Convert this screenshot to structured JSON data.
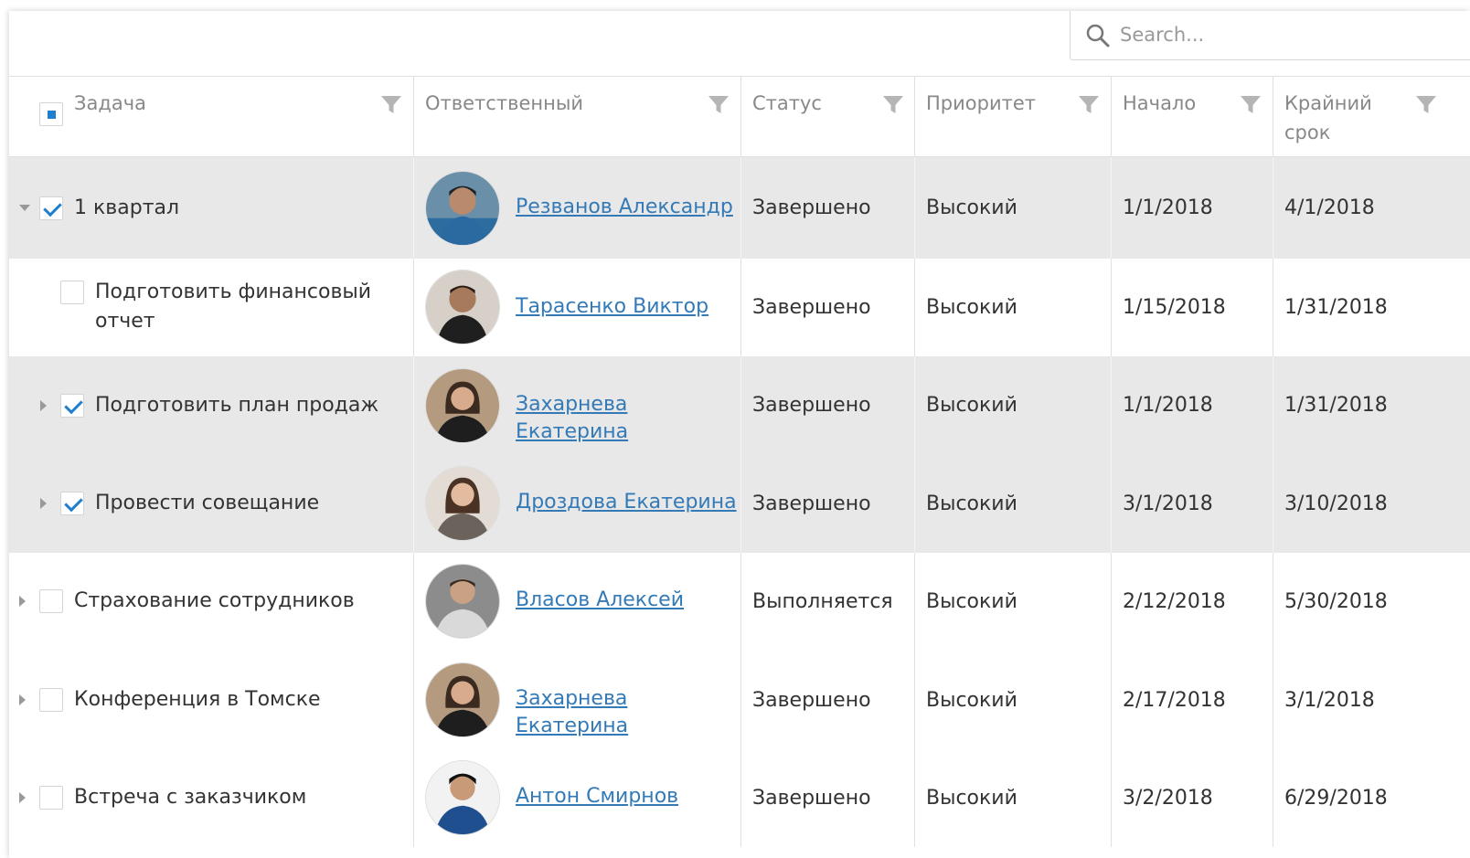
{
  "search": {
    "placeholder": "Search..."
  },
  "columns": {
    "task": "Задача",
    "owner": "Ответственный",
    "status": "Статус",
    "priority": "Приоритет",
    "start": "Начало",
    "deadline_line1": "Крайний",
    "deadline_line2": "срок"
  },
  "rows": [
    {
      "task": "1 квартал",
      "owner": "Резванов Александр",
      "status": "Завершено",
      "priority": "Высокий",
      "start": "1/1/2018",
      "deadline": "4/1/2018",
      "selected": true,
      "checked": true,
      "expanded": true,
      "level": 0
    },
    {
      "task_line1": "Подготовить финансовый",
      "task_line2": "отчет",
      "owner": "Тарасенко Виктор",
      "status": "Завершено",
      "priority": "Высокий",
      "start": "1/15/2018",
      "deadline": "1/31/2018",
      "selected": false,
      "checked": false,
      "level": 1
    },
    {
      "task": "Подготовить план продаж",
      "owner": "Захарнева Екатерина",
      "status": "Завершено",
      "priority": "Высокий",
      "start": "1/1/2018",
      "deadline": "1/31/2018",
      "selected": true,
      "checked": true,
      "level": 1
    },
    {
      "task": "Провести совещание",
      "owner": "Дроздова Екатерина",
      "status": "Завершено",
      "priority": "Высокий",
      "start": "3/1/2018",
      "deadline": "3/10/2018",
      "selected": true,
      "checked": true,
      "level": 1
    },
    {
      "task": "Страхование сотрудников",
      "owner": "Власов Алексей",
      "status": "Выполняется",
      "priority": "Высокий",
      "start": "2/12/2018",
      "deadline": "5/30/2018",
      "selected": false,
      "checked": false,
      "level": 0
    },
    {
      "task": "Конференция в Томске",
      "owner": "Захарнева Екатерина",
      "status": "Завершено",
      "priority": "Высокий",
      "start": "2/17/2018",
      "deadline": "3/1/2018",
      "selected": false,
      "checked": false,
      "level": 0
    },
    {
      "task": "Встреча с заказчиком",
      "owner": "Антон Смирнов",
      "status": "Завершено",
      "priority": "Высокий",
      "start": "3/2/2018",
      "deadline": "6/29/2018",
      "selected": false,
      "checked": false,
      "level": 0
    }
  ],
  "colors": {
    "accent": "#1e7fcf",
    "link": "#337ab7",
    "selected_row": "#e8e8e8",
    "header_text": "#888888"
  }
}
